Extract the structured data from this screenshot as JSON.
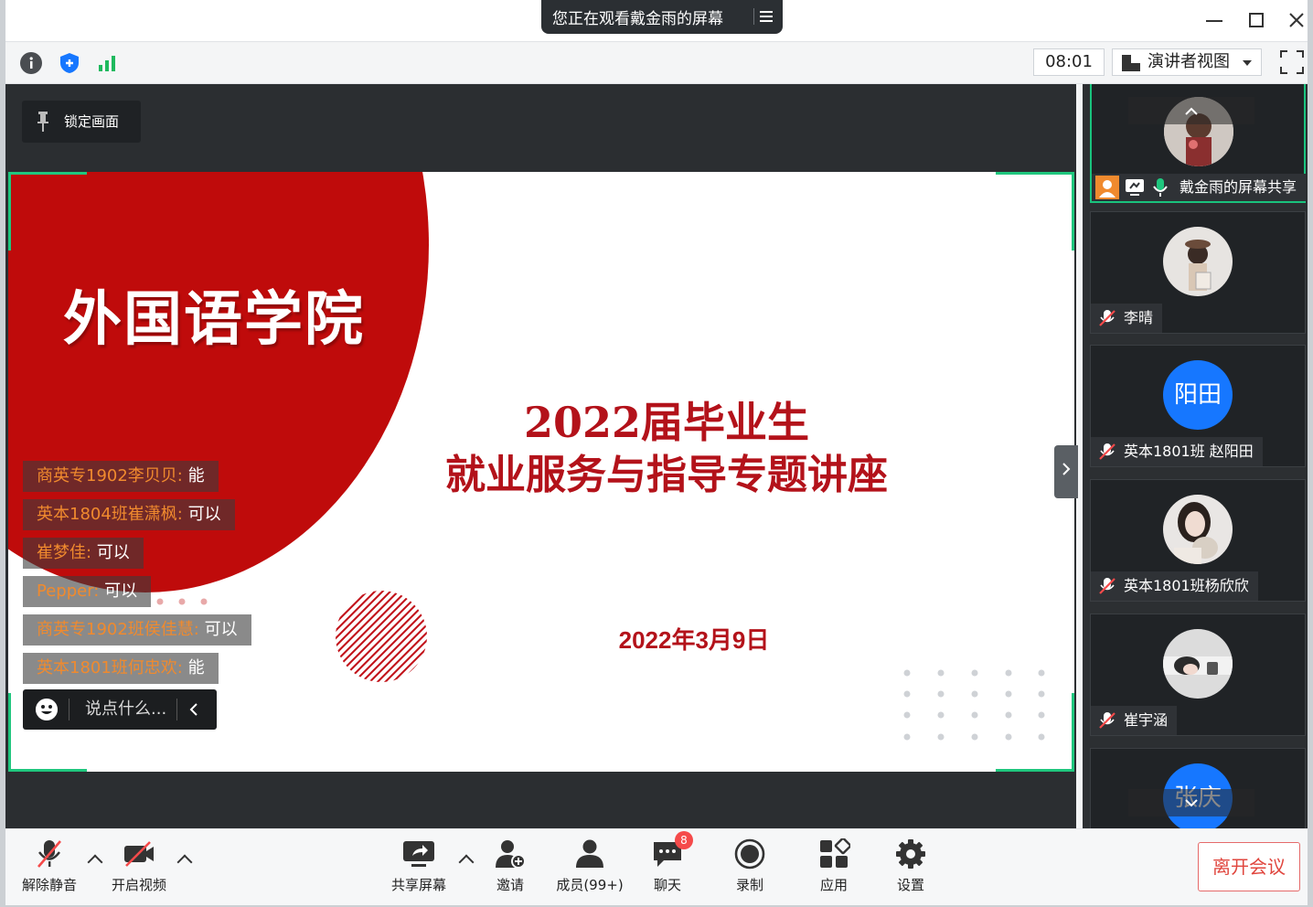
{
  "titlebar": {
    "share_notice": "您正在观看戴金雨的屏幕"
  },
  "toolbar": {
    "timer": "08:01",
    "view_mode": "演讲者视图"
  },
  "stage": {
    "lock_label": "锁定画面",
    "slide": {
      "college": "外国语学院",
      "title_line1": "2022届毕业生",
      "title_line2": "就业服务与指导专题讲座",
      "date": "2022年3月9日"
    },
    "chat": {
      "messages": [
        {
          "name": "商英专1902李贝贝:",
          "text": " 能"
        },
        {
          "name": "英本1804班崔潇枫:",
          "text": " 可以"
        },
        {
          "name": "崔梦佳:",
          "text": " 可以"
        },
        {
          "name": "Pepper:",
          "text": " 可以"
        },
        {
          "name": "商英专1902班侯佳慧:",
          "text": " 可以"
        },
        {
          "name": "英本1801班何忠欢:",
          "text": " 能"
        }
      ],
      "input_placeholder": "说点什么..."
    }
  },
  "participants": [
    {
      "name": "戴金雨的屏幕共享",
      "avatar": "photo"
    },
    {
      "name": "李晴",
      "avatar": "photo"
    },
    {
      "name": "英本1801班 赵阳田",
      "avatar_text": "阳田"
    },
    {
      "name": "英本1801班杨欣欣",
      "avatar": "photo"
    },
    {
      "name": "崔宇涵",
      "avatar": "photo"
    },
    {
      "name": "",
      "avatar_text": "张庆"
    }
  ],
  "bottombar": {
    "unmute": "解除静音",
    "start_video": "开启视频",
    "share_screen": "共享屏幕",
    "invite": "邀请",
    "members": "成员(99+)",
    "chat": "聊天",
    "chat_badge": "8",
    "record": "录制",
    "apps": "应用",
    "settings": "设置",
    "leave": "离开会议"
  },
  "colors": {
    "accent_green": "#1fc77e",
    "slide_red": "#bf0b0b",
    "avatar_blue": "#1677ff",
    "leave_red": "#e0463e"
  }
}
